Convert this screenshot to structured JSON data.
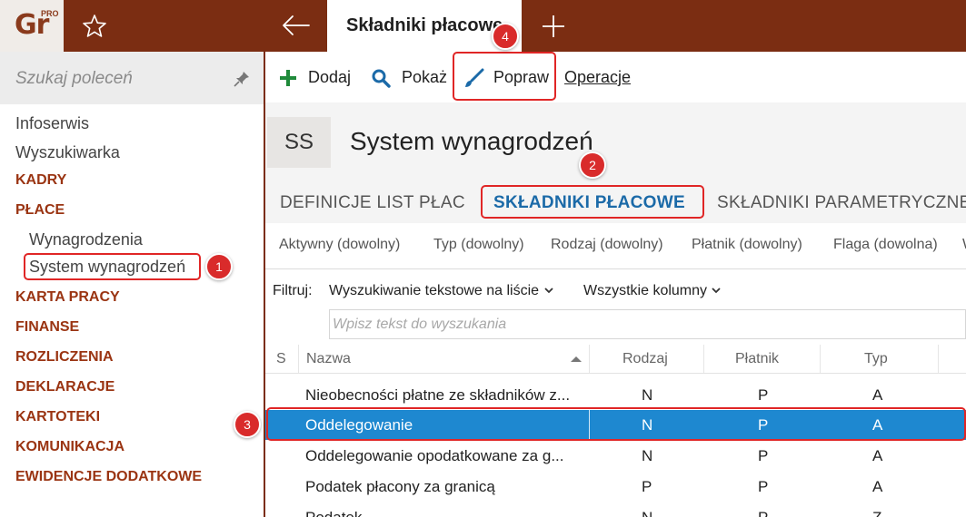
{
  "app": {
    "logo_text": "Gr",
    "logo_superscript": "PRO"
  },
  "topbar": {
    "active_tab_title": "Składniki płacowe",
    "icons": [
      "star-icon",
      "back-arrow-icon",
      "plus-icon"
    ]
  },
  "sidebar": {
    "search_placeholder": "Szukaj poleceń",
    "items": [
      {
        "label": "Infoserwis",
        "type": "plain"
      },
      {
        "label": "Wyszukiwarka",
        "type": "plain"
      },
      {
        "label": "KADRY",
        "type": "category"
      },
      {
        "label": "PŁACE",
        "type": "category"
      },
      {
        "label": "Wynagrodzenia",
        "type": "sub"
      },
      {
        "label": "System wynagrodzeń",
        "type": "sub"
      },
      {
        "label": "KARTA PRACY",
        "type": "category"
      },
      {
        "label": "FINANSE",
        "type": "category"
      },
      {
        "label": "ROZLICZENIA",
        "type": "category"
      },
      {
        "label": "DEKLARACJE",
        "type": "category"
      },
      {
        "label": "KARTOTEKI",
        "type": "category"
      },
      {
        "label": "KOMUNIKACJA",
        "type": "category"
      },
      {
        "label": "EWIDENCJE DODATKOWE",
        "type": "category"
      }
    ]
  },
  "toolbar": {
    "add_label": "Dodaj",
    "show_label": "Pokaż",
    "edit_label": "Popraw",
    "operations_label": "Operacje"
  },
  "header": {
    "initials": "SS",
    "title": "System wynagrodzeń"
  },
  "tabs": [
    {
      "label": "DEFINICJE LIST PŁAC",
      "selected": false
    },
    {
      "label": "SKŁADNIKI PŁACOWE",
      "selected": true
    },
    {
      "label": "SKŁADNIKI PARAMETRYCZNE",
      "selected": false
    }
  ],
  "quick_filters": [
    "Aktywny (dowolny)",
    "Typ (dowolny)",
    "Rodzaj (dowolny)",
    "Płatnik (dowolny)",
    "Flaga (dowolna)",
    "W"
  ],
  "filter": {
    "label": "Filtruj:",
    "mode": "Wyszukiwanie tekstowe na liście",
    "columns": "Wszystkie kolumny",
    "search_placeholder": "Wpisz tekst do wyszukania",
    "search_value": ""
  },
  "table": {
    "columns": [
      "S",
      "Nazwa",
      "Rodzaj",
      "Płatnik",
      "Typ"
    ],
    "rows": [
      {
        "s": "",
        "nazwa": "Nieobecności płatne ze składników z...",
        "rodzaj": "N",
        "platnik": "P",
        "typ": "A",
        "selected": false
      },
      {
        "s": "",
        "nazwa": "Oddelegowanie",
        "rodzaj": "N",
        "platnik": "P",
        "typ": "A",
        "selected": true
      },
      {
        "s": "",
        "nazwa": "Oddelegowanie opodatkowane za g...",
        "rodzaj": "N",
        "platnik": "P",
        "typ": "A",
        "selected": false
      },
      {
        "s": "",
        "nazwa": "Podatek płacony za granicą",
        "rodzaj": "P",
        "platnik": "P",
        "typ": "A",
        "selected": false
      },
      {
        "s": "",
        "nazwa": "Podatek ...",
        "rodzaj": "N",
        "platnik": "P",
        "typ": "Z",
        "selected": false
      }
    ]
  },
  "annotations": [
    "1",
    "2",
    "3",
    "4"
  ],
  "colors": {
    "topbar": "#7b2d12",
    "category": "#9a3412",
    "accent_blue": "#1b6aa8",
    "selection": "#1e88d0",
    "highlight": "#e02626"
  }
}
